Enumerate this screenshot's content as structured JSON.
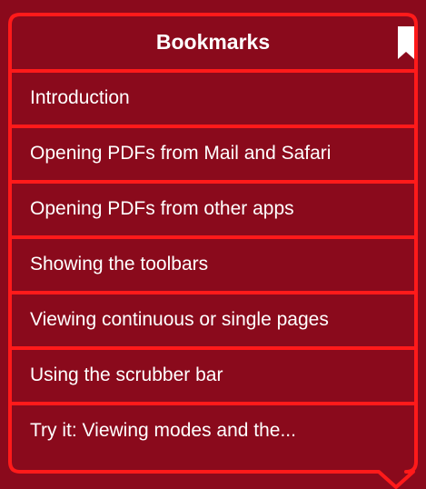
{
  "panel": {
    "title": "Bookmarks",
    "header_icon": "bookmark-icon",
    "colors": {
      "background": "#8a0a1c",
      "panel": "#8a0a1c",
      "border": "#ff1a1a",
      "text": "#ffffff"
    }
  },
  "bookmarks": [
    {
      "label": "Introduction"
    },
    {
      "label": "Opening PDFs from Mail and Safari"
    },
    {
      "label": "Opening PDFs from other apps"
    },
    {
      "label": "Showing the toolbars"
    },
    {
      "label": "Viewing continuous or single pages"
    },
    {
      "label": "Using the scrubber bar"
    },
    {
      "label": "Try it: Viewing modes and the..."
    }
  ]
}
